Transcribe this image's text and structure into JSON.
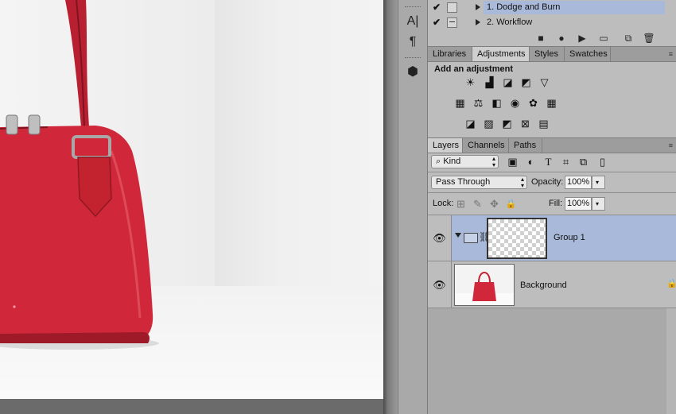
{
  "canvas": {
    "image_description_colors": {
      "bag": "#d0283a",
      "bag_shadow": "#9e1a28",
      "wall": "#eeeeee",
      "floor": "#f6f6f6"
    }
  },
  "tools": [
    {
      "icon": "type-vertical-icon",
      "glyph": "A|"
    },
    {
      "icon": "paragraph-icon",
      "glyph": "¶"
    },
    {
      "icon": "3d-cube-icon",
      "glyph": "⬢"
    }
  ],
  "history": {
    "items": [
      {
        "label": "1. Dodge and Burn",
        "checked": true,
        "selected": true
      },
      {
        "label": "2. Workflow",
        "checked": true,
        "selected": false
      }
    ],
    "actions": [
      {
        "icon": "stop-icon",
        "glyph": "■"
      },
      {
        "icon": "record-icon",
        "glyph": "●"
      },
      {
        "icon": "play-icon",
        "glyph": "▶"
      },
      {
        "icon": "new-set-folder-icon",
        "glyph": "▭"
      },
      {
        "icon": "new-action-icon",
        "glyph": "⧉"
      },
      {
        "icon": "trash-icon",
        "glyph": "🗑"
      }
    ]
  },
  "adjustments_panel": {
    "tabs": [
      "Libraries",
      "Adjustments",
      "Styles",
      "Swatches"
    ],
    "active_tab": "Adjustments",
    "title": "Add an adjustment",
    "rows": [
      [
        {
          "icon": "brightness-contrast-icon",
          "glyph": "☀"
        },
        {
          "icon": "levels-icon",
          "glyph": "▟"
        },
        {
          "icon": "curves-icon",
          "glyph": "◪"
        },
        {
          "icon": "exposure-icon",
          "glyph": "◩"
        },
        {
          "icon": "vibrance-icon",
          "glyph": "▽"
        }
      ],
      [
        {
          "icon": "hue-saturation-icon",
          "glyph": "▦"
        },
        {
          "icon": "color-balance-icon",
          "glyph": "⚖"
        },
        {
          "icon": "black-white-icon",
          "glyph": "◧"
        },
        {
          "icon": "photo-filter-icon",
          "glyph": "◉"
        },
        {
          "icon": "channel-mixer-icon",
          "glyph": "✿"
        },
        {
          "icon": "color-lookup-icon",
          "glyph": "▦"
        }
      ],
      [
        {
          "icon": "invert-icon",
          "glyph": "◪"
        },
        {
          "icon": "posterize-icon",
          "glyph": "▨"
        },
        {
          "icon": "threshold-icon",
          "glyph": "◩"
        },
        {
          "icon": "selective-color-icon",
          "glyph": "⊠"
        },
        {
          "icon": "gradient-map-icon",
          "glyph": "▤"
        }
      ]
    ]
  },
  "layers_panel": {
    "tabs": [
      "Layers",
      "Channels",
      "Paths"
    ],
    "active_tab": "Layers",
    "filter": {
      "label": "Kind",
      "icon": "search-icon"
    },
    "filter_icons": [
      {
        "icon": "pixel-filter-icon",
        "glyph": "▣"
      },
      {
        "icon": "adjustment-filter-icon",
        "glyph": "◐"
      },
      {
        "icon": "type-filter-icon",
        "glyph": "T"
      },
      {
        "icon": "shape-filter-icon",
        "glyph": "⌗"
      },
      {
        "icon": "smart-object-filter-icon",
        "glyph": "⧉"
      },
      {
        "icon": "filter-toggle-icon",
        "glyph": "▯"
      }
    ],
    "blend_mode": "Pass Through",
    "opacity_label": "Opacity:",
    "opacity": "100%",
    "lock_label": "Lock:",
    "lock_icons": [
      {
        "icon": "lock-transparent-icon",
        "glyph": "⊞"
      },
      {
        "icon": "lock-image-icon",
        "glyph": "✎"
      },
      {
        "icon": "lock-position-icon",
        "glyph": "✥"
      },
      {
        "icon": "lock-all-icon",
        "glyph": "🔒"
      }
    ],
    "fill_label": "Fill:",
    "fill": "100%",
    "layers": [
      {
        "name": "Group 1",
        "type": "group",
        "visible": true,
        "selected": true
      },
      {
        "name": "Background",
        "type": "background",
        "visible": true,
        "selected": false,
        "locked": true
      }
    ]
  },
  "colors": {
    "selection": "#a9b9d9",
    "panel_bg": "#bdbdbd",
    "bag_red": "#d0283a"
  }
}
